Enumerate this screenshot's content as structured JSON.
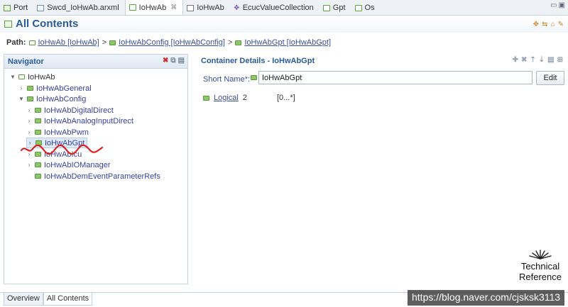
{
  "tabs": [
    {
      "label": "Port",
      "icon": "port-icon"
    },
    {
      "label": "Swcd_IoHwAb.arxml",
      "icon": "file-icon"
    },
    {
      "label": "IoHwAb",
      "icon": "module-icon",
      "active": true,
      "close": "⌘"
    },
    {
      "label": "IoHwAb",
      "icon": "module-icon"
    },
    {
      "label": "EcucValueCollection",
      "icon": "collection-icon"
    },
    {
      "label": "Gpt",
      "icon": "folder-icon"
    },
    {
      "label": "Os",
      "icon": "folder-icon"
    }
  ],
  "header": {
    "title": "All Contents"
  },
  "path": {
    "label": "Path:",
    "segments": [
      "IoHwAb [IoHwAb]",
      "IoHwAbConfig [IoHwAbConfig]",
      "IoHwAbGpt [IoHwAbGpt]"
    ],
    "separator": ">"
  },
  "navigator": {
    "title": "Navigator",
    "tree": {
      "root": "IoHwAb",
      "general": "IoHwAbGeneral",
      "config": "IoHwAbConfig",
      "digital": "IoHwAbDigitalDirect",
      "analog": "IoHwAbAnalogInputDirect",
      "pwm": "IoHwAbPwm",
      "gpt": "IoHwAbGpt",
      "icu": "IoHwAbIcu",
      "iomanager": "IoHwAbIOManager",
      "dem": "IoHwAbDemEventParameterRefs"
    }
  },
  "details": {
    "title": "Container Details - IoHwAbGpt",
    "short_name_label": "Short Name*:",
    "short_name_value": "IoHwAbGpt",
    "edit_label": "Edit",
    "logical_label": "Logical",
    "logical_count": "2",
    "multiplicity": "[0...*]"
  },
  "bottom_tabs": [
    "Overview",
    "All Contents"
  ],
  "watermark": {
    "line1": "Technical",
    "line2": "Reference",
    "url": "https://blog.naver.com/cjsksk3113"
  },
  "colors": {
    "accent": "#2a5a9a",
    "link": "#3a4ea0",
    "folder": "#8cc56a",
    "annotation": "#e02020"
  }
}
